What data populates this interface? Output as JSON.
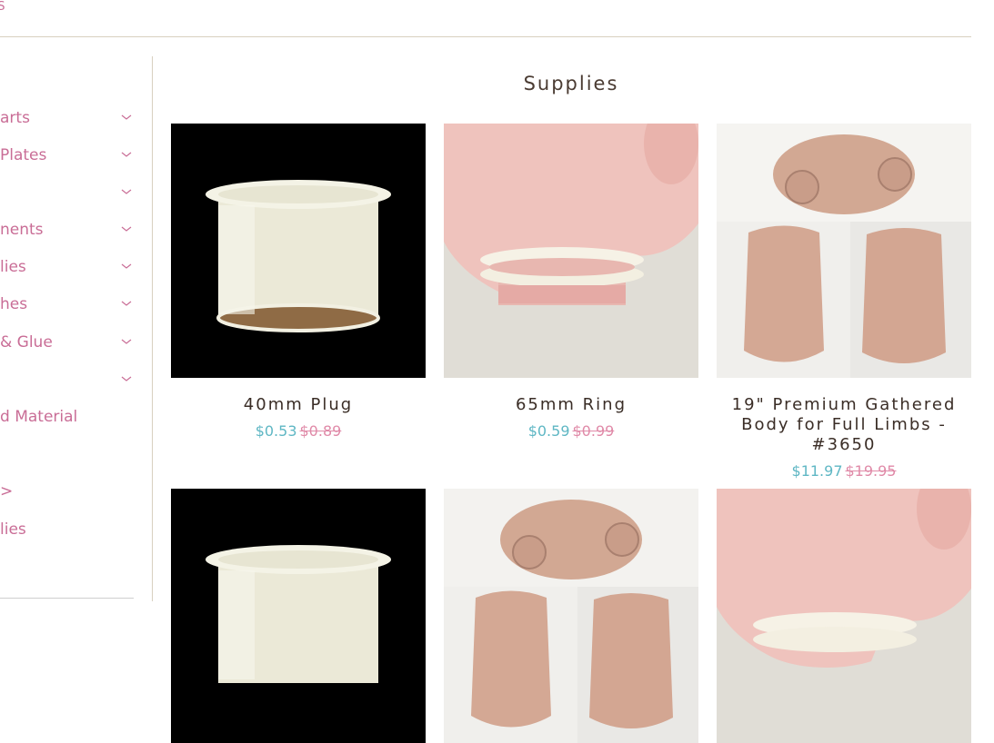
{
  "header": {
    "crumb": "ES"
  },
  "sidebar": {
    "items": [
      {
        "label": "arts",
        "chevron": true
      },
      {
        "label": "Plates",
        "chevron": true
      },
      {
        "label": "",
        "chevron": true
      },
      {
        "label": "nents",
        "chevron": true
      },
      {
        "label": "lies",
        "chevron": true
      },
      {
        "label": "hes",
        "chevron": true
      },
      {
        "label": "& Glue",
        "chevron": true
      },
      {
        "label": "",
        "chevron": true
      },
      {
        "label": "d Material",
        "chevron": false
      },
      {
        "label": ">",
        "chevron": false
      },
      {
        "label": "lies",
        "chevron": false
      }
    ]
  },
  "main": {
    "title": "Supplies",
    "products": [
      {
        "name": "40mm Plug",
        "price": "$0.53",
        "compare_price": "$0.89",
        "image": "plug"
      },
      {
        "name": "65mm Ring",
        "price": "$0.59",
        "compare_price": "$0.99",
        "image": "ring"
      },
      {
        "name": "19\" Premium Gathered Body for Full Limbs - #3650",
        "price": "$11.97",
        "compare_price": "$19.95",
        "image": "body"
      },
      {
        "name": "",
        "price": "",
        "compare_price": "",
        "image": "plug"
      },
      {
        "name": "",
        "price": "",
        "compare_price": "",
        "image": "body"
      },
      {
        "name": "",
        "price": "",
        "compare_price": "",
        "image": "ring"
      }
    ]
  },
  "colors": {
    "accent_pink": "#c96d96",
    "sale_price": "#5fb7c4",
    "compare_price": "#e08aa8",
    "title_text": "#4a3b32",
    "divider": "#d8d0bf"
  }
}
